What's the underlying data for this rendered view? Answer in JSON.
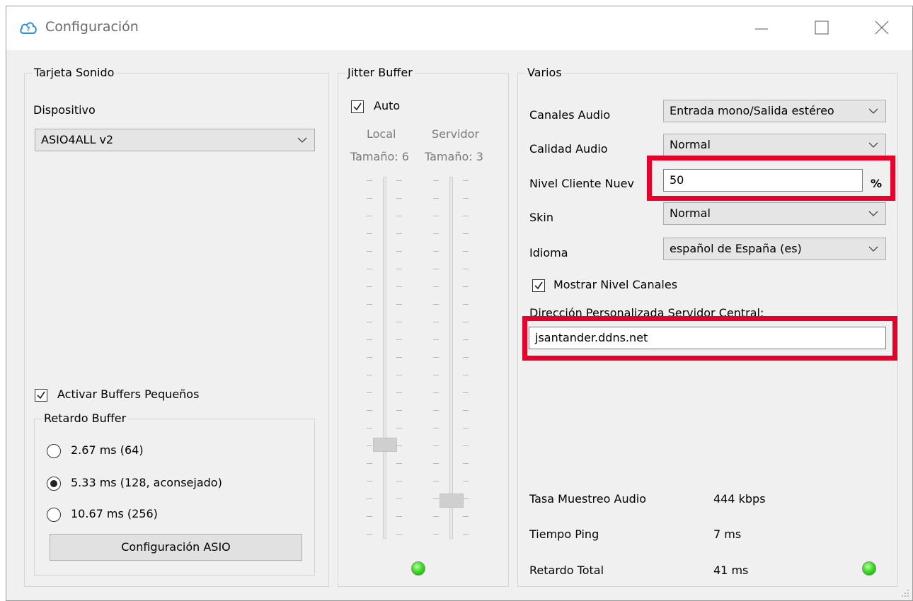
{
  "window": {
    "title": "Configuración",
    "controls": [
      "minimize-icon",
      "maximize-icon",
      "close-icon"
    ]
  },
  "sound_card": {
    "group_title": "Tarjeta Sonido",
    "device_label": "Dispositivo",
    "device_value": "ASIO4ALL v2",
    "small_buffers_label": "Activar Buffers Pequeños",
    "small_buffers_checked": true,
    "buffer_delay": {
      "group_title": "Retardo Buffer",
      "options": [
        {
          "label": "2.67 ms (64)",
          "selected": false
        },
        {
          "label": "5.33 ms (128, aconsejado)",
          "selected": true
        },
        {
          "label": "10.67 ms (256)",
          "selected": false
        }
      ]
    },
    "asio_button": "Configuración ASIO"
  },
  "jitter_buffer": {
    "group_title": "Jitter Buffer",
    "auto_label": "Auto",
    "auto_checked": true,
    "local_label": "Local",
    "server_label": "Servidor",
    "local_size": "Tamaño: 6",
    "server_size": "Tamaño: 3",
    "local_level": 6,
    "server_level": 3,
    "status_color": "#3fdc2a"
  },
  "misc": {
    "group_title": "Varios",
    "audio_channels_label": "Canales Audio",
    "audio_channels_value": "Entrada mono/Salida estéreo",
    "audio_quality_label": "Calidad Audio",
    "audio_quality_value": "Normal",
    "new_client_level_label": "Nivel Cliente Nuev",
    "new_client_level_value": "50",
    "new_client_level_unit": "%",
    "skin_label": "Skin",
    "skin_value": "Normal",
    "language_label": "Idioma",
    "language_value": "español de España (es)",
    "show_channel_levels_label": "Mostrar Nivel Canales",
    "show_channel_levels_checked": true,
    "central_server_label": "Dirección Personalizada Servidor Central:",
    "central_server_value": "jsantander.ddns.net",
    "stats": [
      {
        "label": "Tasa Muestreo Audio",
        "value": "444 kbps"
      },
      {
        "label": "Tiempo Ping",
        "value": "7 ms"
      },
      {
        "label": "Retardo Total",
        "value": "41 ms"
      }
    ],
    "status_color": "#3fdc2a"
  },
  "highlight_color": "#e8002a"
}
